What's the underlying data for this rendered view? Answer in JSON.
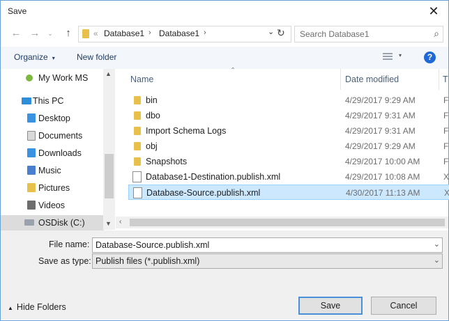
{
  "window": {
    "title": "Save"
  },
  "address": {
    "breadcrumb": [
      {
        "label": "Database1"
      },
      {
        "label": "Database1"
      }
    ],
    "overflow_glyph": "«",
    "search_placeholder": "Search Database1"
  },
  "toolbar": {
    "organize_label": "Organize",
    "new_folder_label": "New folder",
    "help_label": "?"
  },
  "nav": {
    "items": [
      {
        "label": "My Work MS",
        "icon": "onedrive-icon"
      },
      {
        "label": "This PC",
        "icon": "computer-icon"
      },
      {
        "label": "Desktop",
        "icon": "desktop-folder-icon"
      },
      {
        "label": "Documents",
        "icon": "documents-folder-icon"
      },
      {
        "label": "Downloads",
        "icon": "downloads-folder-icon"
      },
      {
        "label": "Music",
        "icon": "music-folder-icon"
      },
      {
        "label": "Pictures",
        "icon": "pictures-folder-icon"
      },
      {
        "label": "Videos",
        "icon": "videos-folder-icon"
      },
      {
        "label": "OSDisk (C:)",
        "icon": "drive-icon"
      }
    ]
  },
  "columns": {
    "name": "Name",
    "date": "Date modified",
    "type": "T"
  },
  "files": [
    {
      "name": "bin",
      "date": "4/29/2017 9:29 AM",
      "type": "F",
      "kind": "folder"
    },
    {
      "name": "dbo",
      "date": "4/29/2017 9:31 AM",
      "type": "F",
      "kind": "folder"
    },
    {
      "name": "Import Schema Logs",
      "date": "4/29/2017 9:31 AM",
      "type": "F",
      "kind": "folder"
    },
    {
      "name": "obj",
      "date": "4/29/2017 9:29 AM",
      "type": "F",
      "kind": "folder"
    },
    {
      "name": "Snapshots",
      "date": "4/29/2017 10:00 AM",
      "type": "F",
      "kind": "folder"
    },
    {
      "name": "Database1-Destination.publish.xml",
      "date": "4/29/2017 10:08 AM",
      "type": "X",
      "kind": "file"
    },
    {
      "name": "Database-Source.publish.xml",
      "date": "4/30/2017 11:13 AM",
      "type": "X",
      "kind": "file",
      "selected": true
    }
  ],
  "form": {
    "filename_label": "File name:",
    "filename_value": "Database-Source.publish.xml",
    "savetype_label": "Save as type:",
    "savetype_value": "Publish files (*.publish.xml)",
    "hide_folders_label": "Hide Folders",
    "save_label": "Save",
    "cancel_label": "Cancel"
  },
  "colors": {
    "accent": "#1f69d6",
    "selection": "#cce8ff",
    "folder": "#e8c04c"
  }
}
